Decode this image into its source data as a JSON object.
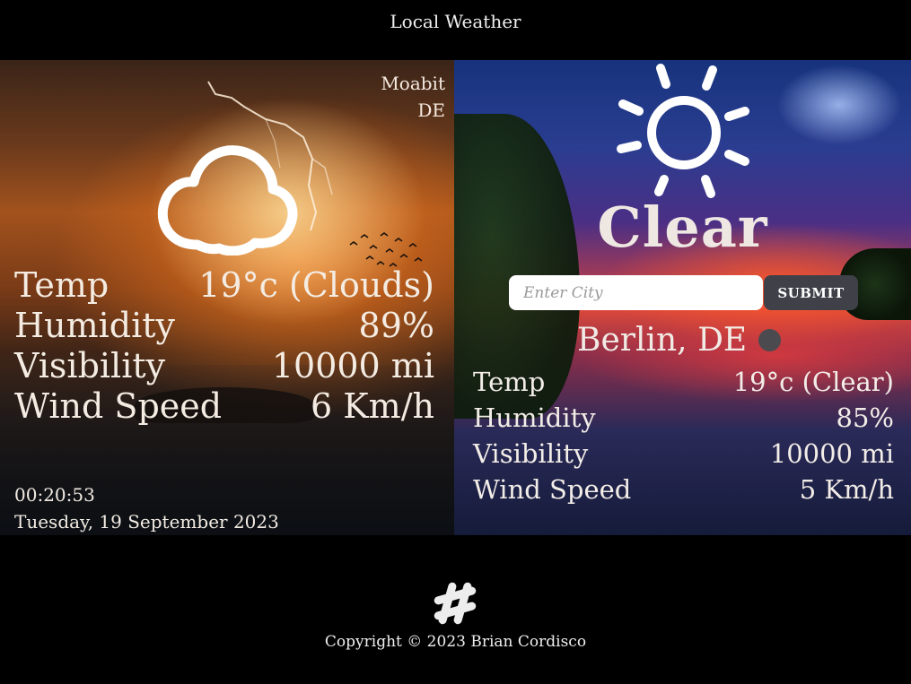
{
  "header": {
    "title": "Local Weather"
  },
  "local": {
    "location": {
      "area": "Moabit",
      "country": "DE"
    },
    "icon": "cloud-icon",
    "stats": [
      {
        "label": "Temp",
        "value": "19°c (Clouds)"
      },
      {
        "label": "Humidity",
        "value": "89%"
      },
      {
        "label": "Visibility",
        "value": "10000 mi"
      },
      {
        "label": "Wind Speed",
        "value": "6 Km/h"
      }
    ],
    "time": "00:20:53",
    "date": "Tuesday, 19 September 2023"
  },
  "search": {
    "icon": "sun-icon",
    "condition": "Clear",
    "input_placeholder": "Enter City",
    "input_value": "",
    "submit_label": "SUBMIT",
    "city": "Berlin, DE",
    "stats": [
      {
        "label": "Temp",
        "value": "19°c (Clear)"
      },
      {
        "label": "Humidity",
        "value": "85%"
      },
      {
        "label": "Visibility",
        "value": "10000 mi"
      },
      {
        "label": "Wind Speed",
        "value": "5 Km/h"
      }
    ]
  },
  "footer": {
    "icon": "slack-icon",
    "copyright": "Copyright © 2023 Brian Cordisco"
  },
  "colors": {
    "background": "#000000",
    "text": "#f2ede6",
    "submit_button": "#3f4048",
    "status_dot": "#4a4a4f"
  }
}
